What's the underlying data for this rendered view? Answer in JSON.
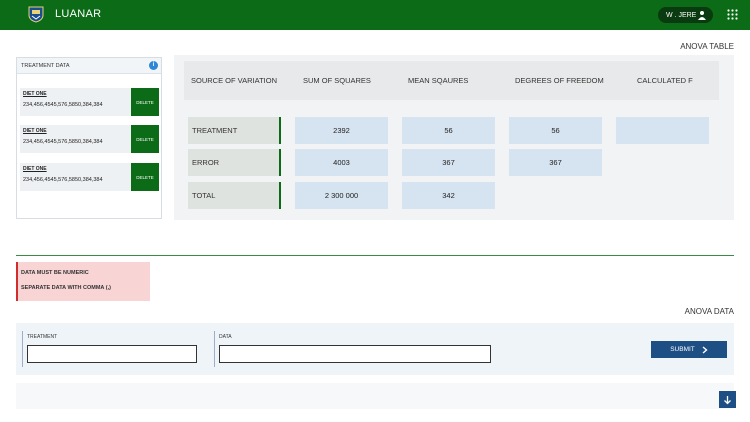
{
  "header": {
    "app_title": "LUANAR",
    "user_name": "W . JERE",
    "brand_color": "#0b6b16"
  },
  "treatment_panel": {
    "title": "TREATMENT DATA",
    "items": [
      {
        "name": "DIET ONE",
        "values": "234,456,4545,576,5850,384,384",
        "delete_label": "DELETE"
      },
      {
        "name": "DIET ONE",
        "values": "234,456,4545,576,5850,384,384",
        "delete_label": "DELETE"
      },
      {
        "name": "DIET ONE",
        "values": "234,456,4545,576,5850,384,384",
        "delete_label": "DELETE"
      }
    ]
  },
  "anova_table": {
    "title": "ANOVA TABLE",
    "headers": [
      "SOURCE OF VARIATION",
      "SUM OF SQUARES",
      "MEAN SQAURES",
      "DEGREES OF FREEDOM",
      "CALCULATED F"
    ],
    "rows": [
      {
        "label": "TREATMENT",
        "sum_of_squares": "2392",
        "mean_squares": "56",
        "degrees_of_freedom": "56",
        "calculated_f": ""
      },
      {
        "label": "ERROR",
        "sum_of_squares": "4003",
        "mean_squares": "367",
        "degrees_of_freedom": "367"
      },
      {
        "label": "TOTAL",
        "sum_of_squares": "2 300 000",
        "mean_squares": "342"
      }
    ]
  },
  "alert": {
    "line1": "DATA MUST BE NUMERIC",
    "line2": "SEPARATE DATA WITH COMMA (,)"
  },
  "anova_data_form": {
    "title": "ANOVA DATA",
    "treatment_label": "TREATMENT",
    "treatment_value": "",
    "data_label": "DATA",
    "data_value": "",
    "submit_label": "SUBMIT"
  }
}
